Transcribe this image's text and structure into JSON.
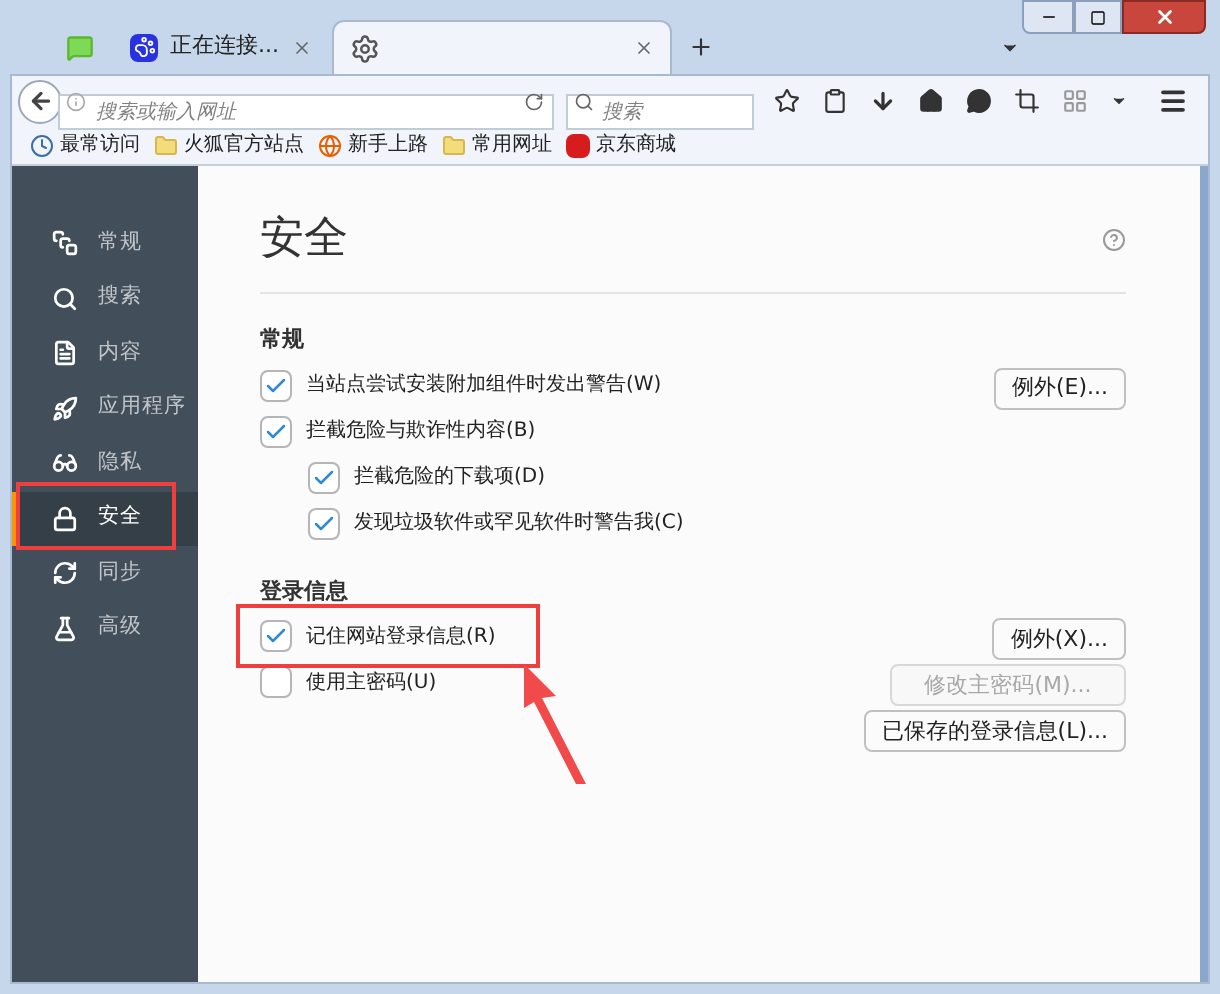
{
  "tabs": [
    {
      "kind": "chat",
      "selected": false
    },
    {
      "kind": "paw",
      "title": "正在连接...",
      "selected": false
    },
    {
      "kind": "gear",
      "selected": true
    }
  ],
  "nav": {
    "url_placeholder": "搜索或输入网址",
    "search_placeholder": "搜索"
  },
  "bookmarks": [
    {
      "kind": "history",
      "label": "最常访问"
    },
    {
      "kind": "folder",
      "label": "火狐官方站点"
    },
    {
      "kind": "globe",
      "label": "新手上路"
    },
    {
      "kind": "folder",
      "label": "常用网址"
    },
    {
      "kind": "jd",
      "label": "京东商城"
    }
  ],
  "sidebar": {
    "items": [
      {
        "label": "常规",
        "selected": false
      },
      {
        "label": "搜索",
        "selected": false
      },
      {
        "label": "内容",
        "selected": false
      },
      {
        "label": "应用程序",
        "selected": false
      },
      {
        "label": "隐私",
        "selected": false
      },
      {
        "label": "安全",
        "selected": true
      },
      {
        "label": "同步",
        "selected": false
      },
      {
        "label": "高级",
        "selected": false
      }
    ]
  },
  "page": {
    "title": "安全",
    "sections": [
      {
        "title": "常规",
        "rows": [
          {
            "label": "当站点尝试安装附加组件时发出警告(W)",
            "checked": true,
            "button": {
              "label": "例外(E)...",
              "disabled": false
            }
          },
          {
            "label": "拦截危险与欺诈性内容(B)",
            "checked": true,
            "children": [
              {
                "label": "拦截危险的下载项(D)",
                "checked": true
              },
              {
                "label": "发现垃圾软件或罕见软件时警告我(C)",
                "checked": true
              }
            ]
          }
        ]
      },
      {
        "title": "登录信息",
        "rows": [
          {
            "label": "记住网站登录信息(R)",
            "checked": true,
            "button": {
              "label": "例外(X)...",
              "disabled": false
            }
          },
          {
            "label": "使用主密码(U)",
            "checked": false,
            "button": {
              "label": "修改主密码(M)...",
              "disabled": true
            }
          },
          {
            "button": {
              "label": "已保存的登录信息(L)...",
              "disabled": false
            }
          }
        ]
      }
    ]
  }
}
